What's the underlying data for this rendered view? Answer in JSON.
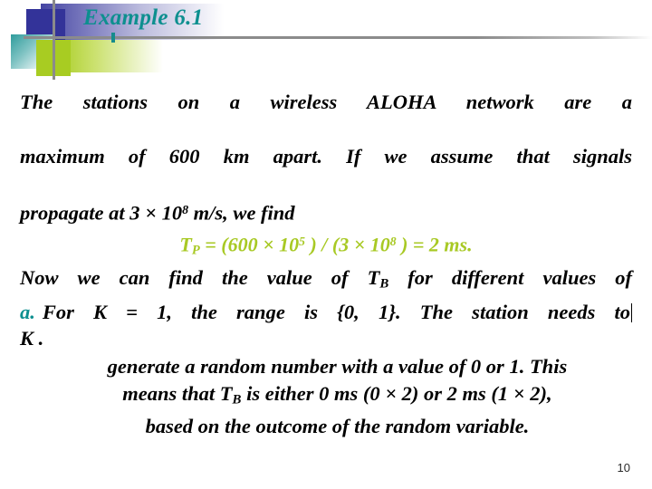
{
  "slide": {
    "title": "Example 6.1",
    "page_number": "10",
    "title_color": "#0d8f8f",
    "formula_color": "#a8c924",
    "marker_color": "#0d8f8f",
    "body_color": "#000000",
    "background_color": "#ffffff"
  },
  "decoration": {
    "square_blue_color": "#333399",
    "square_teal_color": "#2f9c9c",
    "square_green_color": "#a8cc22",
    "rule_color": "#8b8b8b",
    "tick_color": "#168c8c"
  },
  "body": {
    "paragraph_1_line_1": "The stations on a wireless ALOHA network are a",
    "paragraph_1_line_2": "maximum of 600 km apart. If we assume that signals",
    "paragraph_1_line_3": "propagate at 3 × 10",
    "paragraph_1_line_3_exp": "8",
    "paragraph_1_line_3_tail": " m/s,  we find",
    "formula": {
      "symbol": "T",
      "symbol_sub": "P",
      "expression_a": " = (600 × 10",
      "expression_a_exp": "5",
      "expression_b": " ) / (3 × 10",
      "expression_b_exp": "8",
      "expression_c": " ) = 2 ms."
    },
    "paragraph_2_line_1_a": "Now we can find the value of T",
    "paragraph_2_line_1_sub": "B",
    "paragraph_2_line_1_b": " for different values of",
    "paragraph_2_line_2": "K ."
  },
  "list": {
    "marker": "a.",
    "line_1": "For K = 1, the range is {0, 1}. The station needs to",
    "line_2": "generate a random number with a value of 0 or 1. This",
    "line_3_a": "means that T",
    "line_3_sub": "B",
    "line_3_b": " is either 0 ms (0 × 2) or 2 ms (1 × 2),",
    "line_4": "based on the outcome of the random variable."
  }
}
